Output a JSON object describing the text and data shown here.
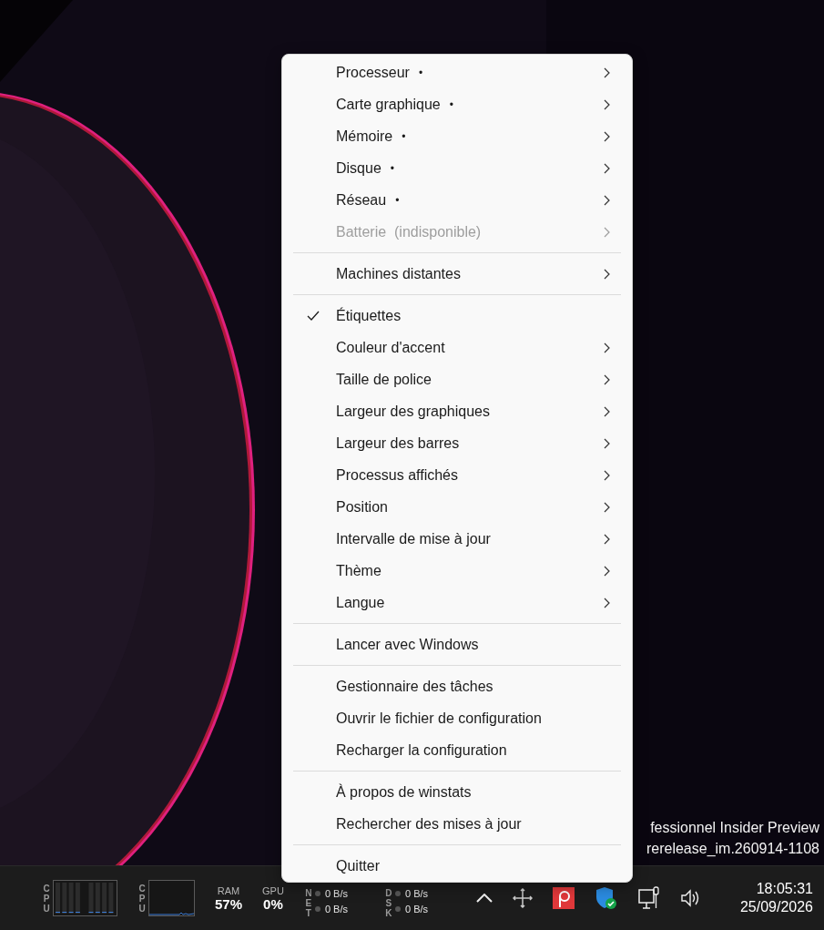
{
  "desktop": {
    "watermark_lines": [
      "fessionnel Insider Preview",
      "rerelease_im.260914-1108"
    ]
  },
  "menu": {
    "groups": [
      {
        "items": [
          {
            "label": "Processeur",
            "marker": "•",
            "submenu": true,
            "checked": false,
            "disabled": false
          },
          {
            "label": "Carte graphique",
            "marker": "•",
            "submenu": true,
            "checked": false,
            "disabled": false
          },
          {
            "label": "Mémoire",
            "marker": "•",
            "submenu": true,
            "checked": false,
            "disabled": false
          },
          {
            "label": "Disque",
            "marker": "•",
            "submenu": true,
            "checked": false,
            "disabled": false
          },
          {
            "label": "Réseau",
            "marker": "•",
            "submenu": true,
            "checked": false,
            "disabled": false
          },
          {
            "label": "Batterie  (indisponible)",
            "submenu": true,
            "checked": false,
            "disabled": true
          }
        ]
      },
      {
        "items": [
          {
            "label": "Machines distantes",
            "submenu": true,
            "checked": false,
            "disabled": false
          }
        ]
      },
      {
        "items": [
          {
            "label": "Étiquettes",
            "submenu": false,
            "checked": true,
            "disabled": false
          },
          {
            "label": "Couleur d'accent",
            "submenu": true,
            "checked": false,
            "disabled": false
          },
          {
            "label": "Taille de police",
            "submenu": true,
            "checked": false,
            "disabled": false
          },
          {
            "label": "Largeur des graphiques",
            "submenu": true,
            "checked": false,
            "disabled": false
          },
          {
            "label": "Largeur des barres",
            "submenu": true,
            "checked": false,
            "disabled": false
          },
          {
            "label": "Processus affichés",
            "submenu": true,
            "checked": false,
            "disabled": false
          },
          {
            "label": "Position",
            "submenu": true,
            "checked": false,
            "disabled": false
          },
          {
            "label": "Intervalle de mise à jour",
            "submenu": true,
            "checked": false,
            "disabled": false
          },
          {
            "label": "Thème",
            "submenu": true,
            "checked": false,
            "disabled": false
          },
          {
            "label": "Langue",
            "submenu": true,
            "checked": false,
            "disabled": false
          }
        ]
      },
      {
        "items": [
          {
            "label": "Lancer avec Windows",
            "submenu": false,
            "checked": false,
            "disabled": false
          }
        ]
      },
      {
        "items": [
          {
            "label": "Gestionnaire des tâches",
            "submenu": false,
            "checked": false,
            "disabled": false
          },
          {
            "label": "Ouvrir le fichier de configuration",
            "submenu": false,
            "checked": false,
            "disabled": false
          },
          {
            "label": "Recharger la configuration",
            "submenu": false,
            "checked": false,
            "disabled": false
          }
        ]
      },
      {
        "items": [
          {
            "label": "À propos de winstats",
            "submenu": false,
            "checked": false,
            "disabled": false
          },
          {
            "label": "Rechercher des mises à jour",
            "submenu": false,
            "checked": false,
            "disabled": false
          }
        ]
      },
      {
        "items": [
          {
            "label": "Quitter",
            "submenu": false,
            "checked": false,
            "disabled": false
          }
        ]
      }
    ]
  },
  "taskbar": {
    "widgets": [
      {
        "kind": "cores",
        "label": "CPU"
      },
      {
        "kind": "history",
        "label": "CPU"
      },
      {
        "kind": "percent",
        "label": "RAM",
        "value": "57%"
      },
      {
        "kind": "percent",
        "label": "GPU",
        "value": "0%"
      },
      {
        "kind": "rates",
        "label": "NET",
        "rates": [
          "0 B/s",
          "0 B/s"
        ]
      },
      {
        "kind": "rates",
        "label": "DSK",
        "rates": [
          "0 B/s",
          "0 B/s"
        ]
      }
    ],
    "clock": {
      "time": "18:05:31",
      "date": "25/09/2026"
    }
  }
}
